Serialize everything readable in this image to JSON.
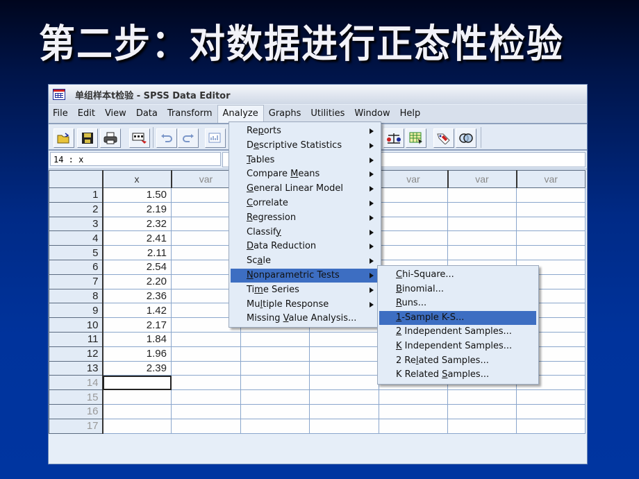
{
  "slide": {
    "title": "第二步：对数据进行正态性检验"
  },
  "window": {
    "title": "单组样本t检验 - SPSS Data Editor",
    "menu": [
      "File",
      "Edit",
      "View",
      "Data",
      "Transform",
      "Analyze",
      "Graphs",
      "Utilities",
      "Window",
      "Help"
    ],
    "active_menu": "Analyze"
  },
  "toolbar": {
    "buttons": [
      "open-file",
      "save",
      "print",
      "dialog-recall",
      "undo",
      "redo",
      "goto-chart",
      "weigh-cases",
      "select-cases",
      "value-labels",
      "use-sets"
    ]
  },
  "cellbar": {
    "reference": "14 : x",
    "value": ""
  },
  "grid": {
    "columns": [
      "x",
      "var",
      "var",
      "var",
      "var",
      "var",
      "var"
    ],
    "rows": [
      {
        "n": "1",
        "x": "1.50"
      },
      {
        "n": "2",
        "x": "2.19"
      },
      {
        "n": "3",
        "x": "2.32"
      },
      {
        "n": "4",
        "x": "2.41"
      },
      {
        "n": "5",
        "x": "2.11"
      },
      {
        "n": "6",
        "x": "2.54"
      },
      {
        "n": "7",
        "x": "2.20"
      },
      {
        "n": "8",
        "x": "2.36"
      },
      {
        "n": "9",
        "x": "1.42"
      },
      {
        "n": "10",
        "x": "2.17"
      },
      {
        "n": "11",
        "x": "1.84"
      },
      {
        "n": "12",
        "x": "1.96"
      },
      {
        "n": "13",
        "x": "2.39"
      },
      {
        "n": "14",
        "x": ""
      },
      {
        "n": "15",
        "x": ""
      },
      {
        "n": "16",
        "x": ""
      },
      {
        "n": "17",
        "x": ""
      }
    ],
    "selected_cell": "14 : x"
  },
  "analyze_menu": {
    "items": [
      {
        "label": "Reports",
        "submenu": true
      },
      {
        "label": "Descriptive Statistics",
        "submenu": true
      },
      {
        "label": "Tables",
        "submenu": true
      },
      {
        "label": "Compare Means",
        "submenu": true
      },
      {
        "label": "General Linear Model",
        "submenu": true
      },
      {
        "label": "Correlate",
        "submenu": true
      },
      {
        "label": "Regression",
        "submenu": true
      },
      {
        "label": "Classify",
        "submenu": true
      },
      {
        "label": "Data Reduction",
        "submenu": true
      },
      {
        "label": "Scale",
        "submenu": true
      },
      {
        "label": "Nonparametric Tests",
        "submenu": true,
        "highlighted": true
      },
      {
        "label": "Time Series",
        "submenu": true
      },
      {
        "label": "Multiple Response",
        "submenu": true
      },
      {
        "label": "Missing Value Analysis...",
        "submenu": false
      }
    ]
  },
  "nonparametric_submenu": {
    "items": [
      {
        "label": "Chi-Square..."
      },
      {
        "label": "Binomial..."
      },
      {
        "label": "Runs..."
      },
      {
        "label": "1-Sample K-S...",
        "highlighted": true
      },
      {
        "label": "2 Independent Samples..."
      },
      {
        "label": "K Independent Samples..."
      },
      {
        "label": "2 Related Samples..."
      },
      {
        "label": "K Related Samples..."
      }
    ]
  },
  "colors": {
    "background_top": "#00061e",
    "background_bottom": "#0035a0",
    "menu_highlight": "#3d6ec2",
    "window_bg": "#e6eef8"
  }
}
